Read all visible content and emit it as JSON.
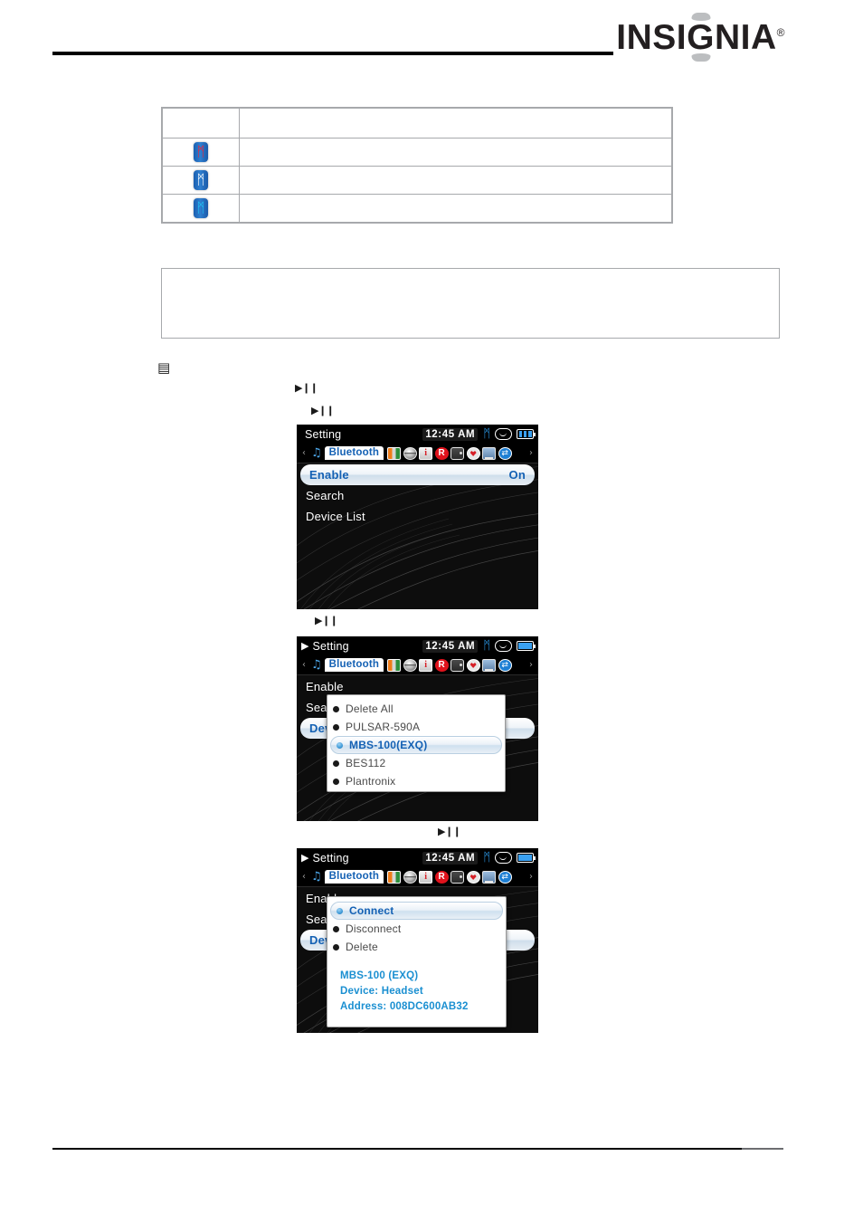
{
  "header": {
    "brand": "INSIGNIA",
    "registered_mark": "®"
  },
  "icon_table": {
    "rows": [
      {
        "icon": "bluetooth-icon-red",
        "description": ""
      },
      {
        "icon": "bluetooth-icon-white",
        "description": ""
      },
      {
        "icon": "bluetooth-icon-cyan",
        "description": ""
      }
    ],
    "header_cells": [
      "",
      ""
    ],
    "bluetooth_glyph": "ᛗ"
  },
  "note_box": {
    "text": ""
  },
  "body_marks": {
    "menu_glyph": "▤",
    "play_pause": "▶❙❙"
  },
  "screens": [
    {
      "id": "screen-bluetooth-menu",
      "status": {
        "play_indicator": "",
        "title": "Setting",
        "clock": "12:45 AM",
        "bluetooth": "bluetooth-icon",
        "headset": "headset-icon",
        "battery": "battery-icon"
      },
      "tabs": {
        "prev_arrow": "‹",
        "next_arrow": "›",
        "music_icon": "♫",
        "active_tab": "Bluetooth",
        "icons": [
          "color-bars-icon",
          "globe-icon",
          "info-icon",
          "radio-icon",
          "display-icon",
          "clock-heart-icon",
          "monitor-icon",
          "sync-icon"
        ]
      },
      "menu": [
        {
          "label": "Enable",
          "value": "On",
          "selected": true
        },
        {
          "label": "Search",
          "value": "",
          "selected": false
        },
        {
          "label": "Device List",
          "value": "",
          "selected": false
        }
      ],
      "popup": null
    },
    {
      "id": "screen-device-list",
      "status": {
        "play_indicator": "▶",
        "title": "Setting",
        "clock": "12:45 AM",
        "bluetooth": "bluetooth-icon",
        "headset": "headset-icon",
        "battery": "battery-icon"
      },
      "tabs": {
        "prev_arrow": "‹",
        "next_arrow": "›",
        "music_icon": "♫",
        "active_tab": "Bluetooth",
        "icons": [
          "color-bars-icon",
          "globe-icon",
          "info-icon",
          "radio-icon",
          "display-icon",
          "clock-heart-icon",
          "monitor-icon",
          "sync-icon"
        ]
      },
      "menu": [
        {
          "label": "Enable",
          "value": "",
          "selected": false
        },
        {
          "label": "Search",
          "value": "",
          "selected": false
        },
        {
          "label": "Device List",
          "value": "",
          "selected": true
        }
      ],
      "popup": {
        "name": "device-list-popup",
        "items": [
          {
            "label": "Delete All",
            "selected": false
          },
          {
            "label": "PULSAR-590A",
            "selected": false
          },
          {
            "label": "MBS-100(EXQ)",
            "selected": true
          },
          {
            "label": "BES112",
            "selected": false
          },
          {
            "label": "Plantronix",
            "selected": false
          }
        ],
        "info": []
      }
    },
    {
      "id": "screen-device-actions",
      "status": {
        "play_indicator": "▶",
        "title": "Setting",
        "clock": "12:45 AM",
        "bluetooth": "bluetooth-icon",
        "headset": "headset-icon",
        "battery": "battery-icon"
      },
      "tabs": {
        "prev_arrow": "‹",
        "next_arrow": "›",
        "music_icon": "♫",
        "active_tab": "Bluetooth",
        "icons": [
          "color-bars-icon",
          "globe-icon",
          "info-icon",
          "radio-icon",
          "display-icon",
          "clock-heart-icon",
          "monitor-icon",
          "sync-icon"
        ]
      },
      "menu": [
        {
          "label": "Enable",
          "value": "",
          "selected": false
        },
        {
          "label": "Search",
          "value": "",
          "selected": false
        },
        {
          "label": "Device List",
          "value": "",
          "selected": true
        }
      ],
      "popup": {
        "name": "device-actions-popup",
        "items": [
          {
            "label": "Connect",
            "selected": true
          },
          {
            "label": "Disconnect",
            "selected": false
          },
          {
            "label": "Delete",
            "selected": false
          }
        ],
        "info": [
          "MBS-100 (EXQ)",
          "Device: Headset",
          "Address: 008DC600AB32"
        ]
      }
    }
  ],
  "colors": {
    "accent_blue": "#1461b4",
    "info_cyan": "#1a8fd1",
    "screen_black": "#0d0d0d",
    "rule_black": "#000000",
    "table_border": "#a7a9ac"
  }
}
